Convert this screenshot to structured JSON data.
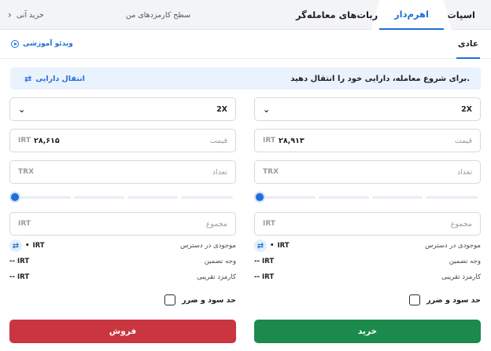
{
  "tabs": {
    "spot": "اسپات",
    "margin": "اهرم‌دار",
    "bots": "ربات‌های معامله‌گر",
    "fee_level": "سطح کارمزدهای من",
    "instant_buy": "خرید آنی"
  },
  "subtabs": {
    "normal": "عادی",
    "video": "ویدئو آموزشی"
  },
  "banner": {
    "message": "برای شروع معامله، دارایی خود را انتقال دهید.",
    "transfer": "انتقال دارایی"
  },
  "buy": {
    "leverage": "2X",
    "price_label": "قیمت",
    "price_value": "۲۸,۹۱۳",
    "price_unit": "IRT",
    "qty_label": "تعداد",
    "qty_unit": "TRX",
    "total_label": "مجموع",
    "total_unit": "IRT",
    "slider_percent": 0,
    "available_label": "موجودی در دسترس",
    "available_value": "IRT",
    "available_dot": "•",
    "margin_label": "وجه تضمین",
    "margin_value": "-- IRT",
    "fee_label": "کارمزد تقریبی",
    "fee_value": "-- IRT",
    "tpsl_label": "حد سود و ضرر",
    "button": "خرید"
  },
  "sell": {
    "leverage": "2X",
    "price_label": "قیمت",
    "price_value": "۲۸,۶۱۵",
    "price_unit": "IRT",
    "qty_label": "تعداد",
    "qty_unit": "TRX",
    "total_label": "مجموع",
    "total_unit": "IRT",
    "slider_percent": 0,
    "available_label": "موجودی در دسترس",
    "available_value": "IRT",
    "available_dot": "•",
    "margin_label": "وجه تضمین",
    "margin_value": "-- IRT",
    "fee_label": "کارمزد تقریبی",
    "fee_value": "-- IRT",
    "tpsl_label": "حد سود و ضرر",
    "button": "فروش"
  },
  "icons": {
    "swap": "swap-arrows-icon",
    "play": "play-circle-icon",
    "chevron_down": "chevron-down-icon",
    "chevron_right": "chevron-right-icon"
  },
  "colors": {
    "accent": "#1e6fd9",
    "buy": "#1b8a4c",
    "sell": "#c9363f",
    "banner_bg": "#eaf2fd"
  }
}
